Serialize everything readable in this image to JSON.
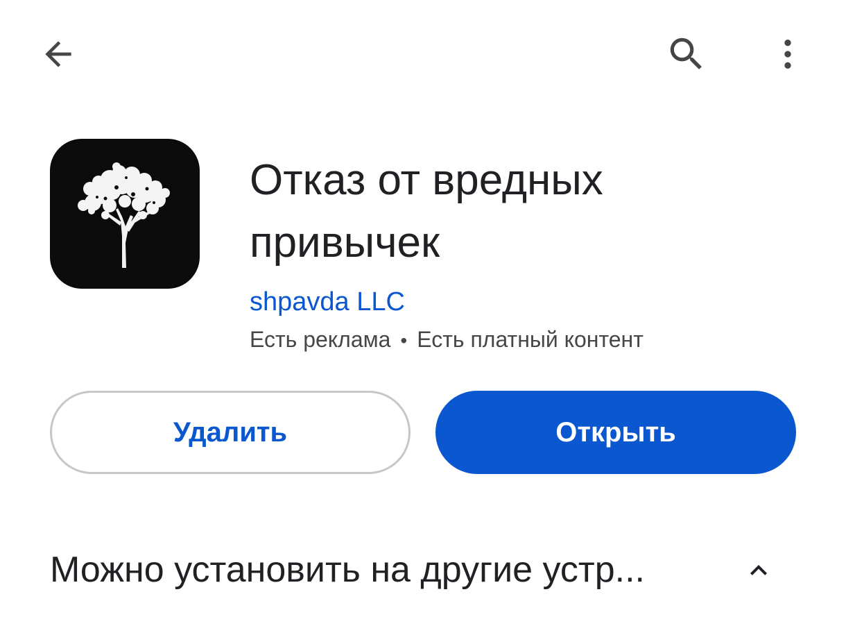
{
  "topbar": {
    "back_icon": "arrow-back-icon",
    "search_icon": "search-icon",
    "more_icon": "more-vert-icon"
  },
  "app": {
    "icon": "tree-icon",
    "title": "Отказ от вредных привычек",
    "developer": "shpavda LLC",
    "meta_ads": "Есть реклама",
    "meta_separator": "•",
    "meta_paid": "Есть платный контент"
  },
  "actions": {
    "uninstall_label": "Удалить",
    "open_label": "Открыть"
  },
  "devices": {
    "title": "Можно установить на другие устр...",
    "chevron_icon": "chevron-up-icon"
  },
  "colors": {
    "accent": "#0b57d0",
    "text": "#202124",
    "secondary_text": "#444746",
    "outline": "#c7c7c7"
  }
}
